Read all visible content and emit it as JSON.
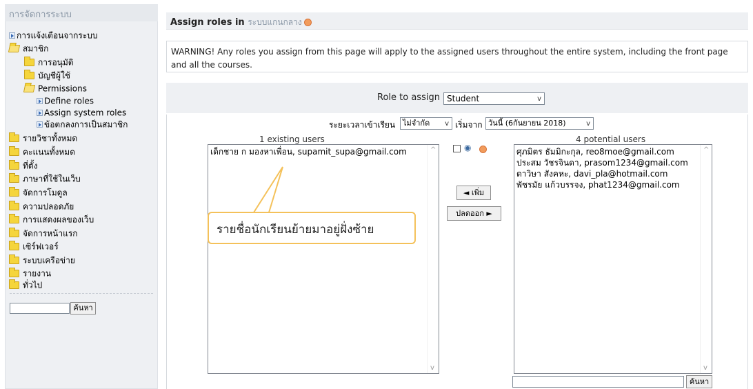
{
  "sidebar": {
    "title": "การจัดการระบบ",
    "items": [
      {
        "label": "การแจ้งเตือนจากระบบ",
        "icon": "arrow-box-icon"
      },
      {
        "label": "สมาชิก",
        "icon": "folder-open-icon"
      },
      {
        "label": "การอนุมัติ",
        "icon": "folder-icon"
      },
      {
        "label": "บัญชีผู้ใช้",
        "icon": "folder-icon"
      },
      {
        "label": "Permissions",
        "icon": "folder-open-icon"
      },
      {
        "label": "Define roles",
        "icon": "arrow-box-icon"
      },
      {
        "label": "Assign system roles",
        "icon": "arrow-box-icon"
      },
      {
        "label": "ข้อตกลงการเป็นสมาชิก",
        "icon": "arrow-box-icon"
      },
      {
        "label": "รายวิชาทั้งหมด",
        "icon": "folder-icon"
      },
      {
        "label": "คะแนนทั้งหมด",
        "icon": "folder-icon"
      },
      {
        "label": "ที่ตั้ง",
        "icon": "folder-icon"
      },
      {
        "label": "ภาษาที่ใช้ในเว็บ",
        "icon": "folder-icon"
      },
      {
        "label": "จัดการโมดูล",
        "icon": "folder-icon"
      },
      {
        "label": "ความปลอดภัย",
        "icon": "folder-icon"
      },
      {
        "label": "การแสดงผลของเว็บ",
        "icon": "folder-icon"
      },
      {
        "label": "จัดการหน้าแรก",
        "icon": "folder-icon"
      },
      {
        "label": "เซิร์ฟเวอร์",
        "icon": "folder-icon"
      },
      {
        "label": "ระบบเครือข่าย",
        "icon": "folder-icon"
      },
      {
        "label": "รายงาน",
        "icon": "folder-icon"
      },
      {
        "label": "ทั่วไป",
        "icon": "folder-icon"
      }
    ],
    "search_button": "ค้นหา"
  },
  "main": {
    "header_title": "Assign roles in",
    "header_context": "ระบบแกนกลาง",
    "warning": "WARNING! Any roles you assign from this page will apply to the assigned users throughout the entire system, including the front page and all the courses.",
    "role_to_assign_label": "Role to assign",
    "role_selected": "Student",
    "enrol_period_label": "ระยะเวลาเข้าเรียน",
    "enrol_period_value": "ไม่จำกัด",
    "start_label": "เริ่มจาก",
    "start_value": "วันนี้ (6กันยายน 2018)",
    "existing_header": "1 existing users",
    "potential_header": "4 potential users",
    "existing_users": [
      "เด็กชาย ก มองหาเพื่อน, supamit_supa@gmail.com"
    ],
    "potential_users": [
      "ศุภมิตร ธัมมิกะกุล, reo8moe@gmail.com",
      "ประสม วัชรจินดา, prasom1234@gmail.com",
      "ดาวิษา สังคหะ, davi_pla@hotmail.com",
      "พัชรมัย แก้วบรรจง, phat1234@gmail.com"
    ],
    "add_button": "◄ เพิ่ม",
    "remove_button": "ปลดออก ►",
    "search_button": "ค้นหา"
  },
  "callout": {
    "text": "รายชื่อนักเรียนย้ายมาอยู่ฝั่งซ้าย"
  },
  "colors": {
    "panel_bg": "#eef0f3",
    "folder": "#f5d53c",
    "callout_border": "#f4c15a",
    "help_icon": "#f29c5c"
  }
}
